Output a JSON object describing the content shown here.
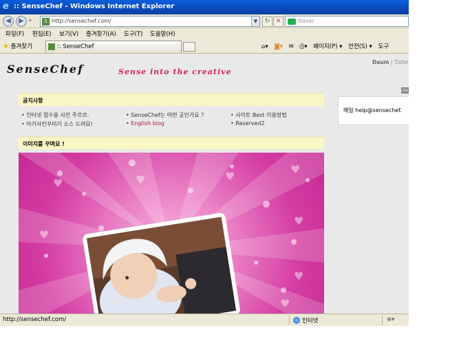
{
  "window": {
    "title": ":: SenseChef - Windows Internet Explorer"
  },
  "address": {
    "url": "http://sensechef.com/",
    "search_placeholder": "Naver"
  },
  "menu": [
    "파일(F)",
    "편집(E)",
    "보기(V)",
    "즐겨찾기(A)",
    "도구(T)",
    "도움말(H)"
  ],
  "favorites_label": "즐겨찾기",
  "tab": {
    "label": ":: SenseChef"
  },
  "commandbar": {
    "page": "페이지(P) ▾",
    "safety": "안전(S) ▾",
    "tools": "도구"
  },
  "site": {
    "logo": "SenseChef",
    "slogan": "Sense into the creative",
    "toplinks": {
      "daum": "Daum",
      "sep": "|",
      "tistory": "Tistory"
    },
    "notice_title": "공지사항",
    "notices": [
      "인터넷 접수용 사진 주르르.",
      "SenseChef는 어떤 곳인가요 ?",
      "사이트 Best 이용방법",
      "아기사진꾸미기 소스 드려요!",
      "English blog",
      "Reserved2"
    ],
    "decorate_title": "이미지를 꾸며요 !",
    "mail": "메일 help@sensechef."
  },
  "status": {
    "url": "http://sensechef.com/",
    "zone": "인터넷"
  }
}
